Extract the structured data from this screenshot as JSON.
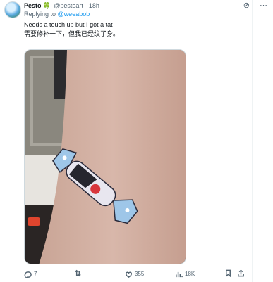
{
  "tweet": {
    "author_name": "Pesto",
    "author_emoji": "🍀",
    "handle_time": "@pestoart · 18h",
    "replying_prefix": "Replying to",
    "replying_handle": "@weeabob",
    "text_en": "Needs a touch up but I got a tat",
    "text_zh": "需要修补一下，但我已经纹了身。"
  },
  "icons": {
    "grok": "grok-icon",
    "more": "more-icon",
    "reply": "reply-icon",
    "repost": "repost-icon",
    "like": "heart-icon",
    "views": "analytics-icon",
    "bookmark": "bookmark-icon",
    "share": "share-icon"
  },
  "actions": {
    "replies": "7",
    "reposts": "",
    "likes": "355",
    "views": "18K"
  }
}
